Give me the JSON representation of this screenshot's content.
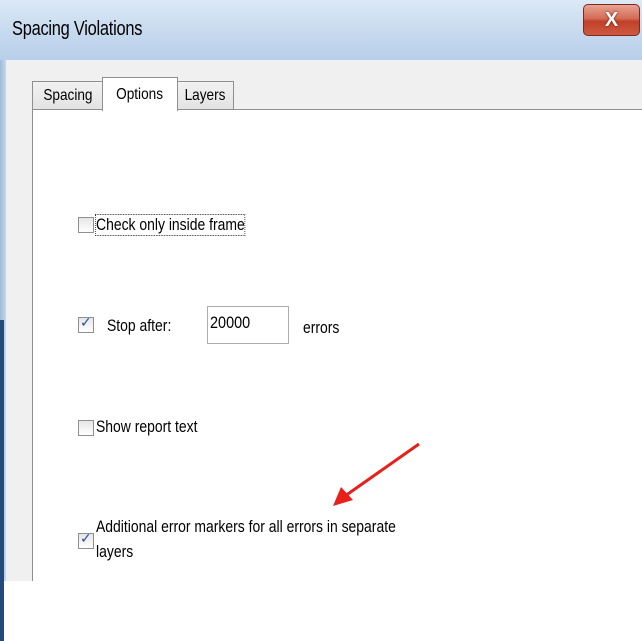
{
  "window": {
    "title": "Spacing Violations",
    "close_label": "X"
  },
  "tabs": [
    {
      "label": "Spacing",
      "active": false
    },
    {
      "label": "Options",
      "active": true
    },
    {
      "label": "Layers",
      "active": false
    }
  ],
  "options": {
    "check_inside_frame": {
      "label": "Check only inside frame",
      "checked": false
    },
    "stop_after": {
      "label": "Stop after:",
      "checked": true,
      "value": "20000",
      "suffix": "errors"
    },
    "show_report_text": {
      "label": "Show report text",
      "checked": false
    },
    "additional_markers": {
      "label_line1": "Additional error markers for all errors in separate",
      "label_line2": "layers",
      "checked": true
    }
  },
  "annotation": {
    "arrow_color": "#e8201c"
  }
}
